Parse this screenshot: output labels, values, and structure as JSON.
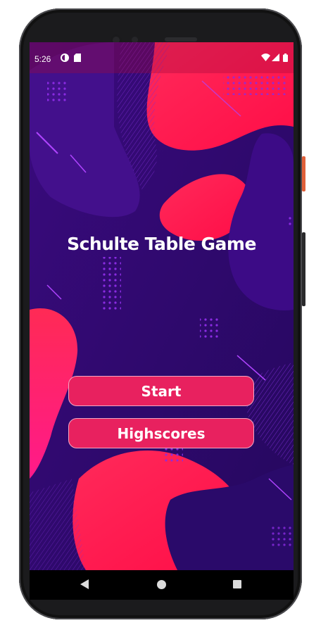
{
  "status_bar": {
    "time": "5:26",
    "icons": [
      "data-saver-icon",
      "sd-card-icon",
      "wifi-icon",
      "signal-icon",
      "battery-icon"
    ]
  },
  "main": {
    "title": "Schulte Table Game",
    "buttons": {
      "start_label": "Start",
      "highscores_label": "Highscores"
    }
  },
  "nav_bar": {
    "icons": [
      "back-icon",
      "home-icon",
      "recent-apps-icon"
    ]
  },
  "colors": {
    "background_purple": "#2f0a72",
    "accent_pink": "#e8215f",
    "blob_red": "#ff1e55"
  }
}
